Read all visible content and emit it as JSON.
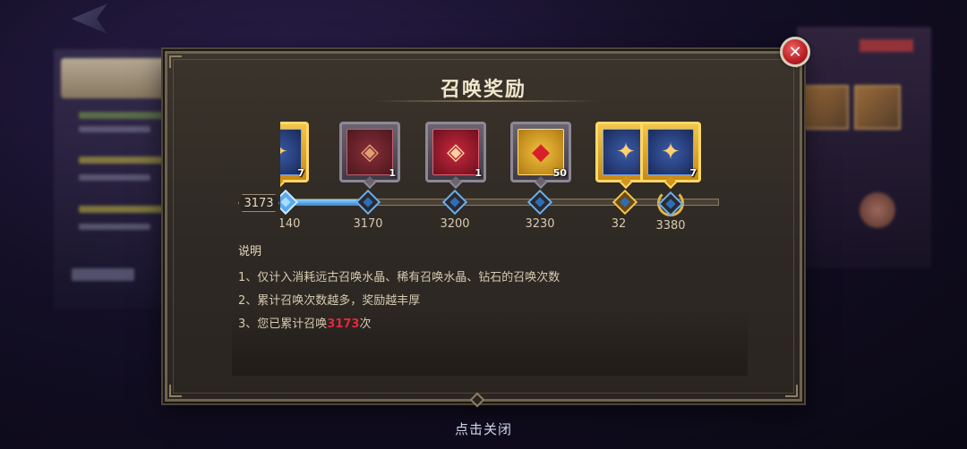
{
  "modal": {
    "title": "召唤奖励",
    "close_symbol": "✕",
    "current_value": "3173",
    "rewards": [
      {
        "count": "7",
        "icon": "blue-relic-icon",
        "tier": "gold"
      },
      {
        "count": "1",
        "icon": "purple-crystal-icon",
        "tier": "silver"
      },
      {
        "count": "1",
        "icon": "red-crystal-icon",
        "tier": "silver"
      },
      {
        "count": "50",
        "icon": "ruby-gem-icon",
        "tier": "silver"
      },
      {
        "count": "",
        "icon": "blue-relic-icon",
        "tier": "gold"
      },
      {
        "count": "7",
        "icon": "blue-relic-icon",
        "tier": "gold"
      }
    ],
    "ticks": [
      "140",
      "3170",
      "3200",
      "3230",
      "32",
      "3380"
    ],
    "description": {
      "heading": "说明",
      "line1": "1、仅计入消耗远古召唤水晶、稀有召唤水晶、钻石的召唤次数",
      "line2": "2、累计召唤次数越多，奖励越丰厚",
      "line3_prefix": "3、您已累计召唤",
      "line3_value": "3173",
      "line3_suffix": "次"
    }
  },
  "footer": {
    "tap_to_close": "点击关闭"
  },
  "colors": {
    "accent_blue": "#5aaaf0",
    "gold": "#f2c64a",
    "highlight_red": "#e8263c",
    "close_red": "#b81f24"
  }
}
